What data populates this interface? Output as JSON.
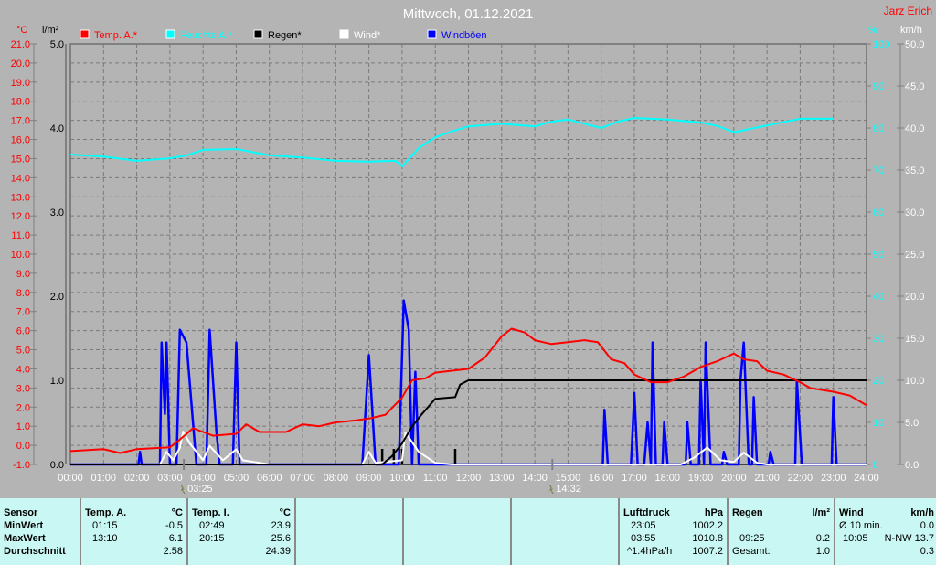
{
  "title": "Mittwoch, 01.12.2021",
  "author": "Jarz Erich",
  "units": {
    "temp": "°C",
    "rain": "l/m²",
    "humidity": "%",
    "wind": "km/h"
  },
  "legend": [
    {
      "label": "Temp. A.*",
      "color": "#ff0000"
    },
    {
      "label": "Feuchte A.*",
      "color": "#00ffff"
    },
    {
      "label": "Regen*",
      "color": "#000000"
    },
    {
      "label": "Wind*",
      "color": "#ffffff"
    },
    {
      "label": "Windböen",
      "color": "#0000ff"
    }
  ],
  "markers": [
    {
      "time": "03:25",
      "hour": 3.42,
      "icon": "sunrise-icon"
    },
    {
      "time": "14:32",
      "hour": 14.53,
      "icon": "sunset-icon"
    }
  ],
  "chart_data": {
    "type": "line",
    "title": "Mittwoch, 01.12.2021",
    "x_ticks": [
      "00:00",
      "01:00",
      "02:00",
      "03:00",
      "04:00",
      "05:00",
      "06:00",
      "07:00",
      "08:00",
      "09:00",
      "10:00",
      "11:00",
      "12:00",
      "13:00",
      "14:00",
      "15:00",
      "16:00",
      "17:00",
      "18:00",
      "19:00",
      "20:00",
      "21:00",
      "22:00",
      "23:00",
      "24:00"
    ],
    "xlim": [
      0,
      24
    ],
    "axes": {
      "temp": {
        "ylim": [
          -1,
          21
        ],
        "ticks": [
          "21.0",
          "20.0",
          "19.0",
          "18.0",
          "17.0",
          "16.0",
          "15.0",
          "14.0",
          "13.0",
          "12.0",
          "11.0",
          "10.0",
          "9.0",
          "8.0",
          "7.0",
          "6.0",
          "5.0",
          "4.0",
          "3.0",
          "2.0",
          "1.0",
          "0.0",
          "-1.0"
        ],
        "color": "#ff0000"
      },
      "rain": {
        "ylim": [
          0,
          5
        ],
        "ticks": [
          "5.0",
          "4.0",
          "3.0",
          "2.0",
          "1.0",
          "0.0"
        ],
        "color": "#000000"
      },
      "humidity": {
        "ylim": [
          0,
          100
        ],
        "ticks": [
          "100",
          "90",
          "80",
          "70",
          "60",
          "50",
          "40",
          "30",
          "20",
          "10",
          "0"
        ],
        "color": "#00ffff"
      },
      "wind": {
        "ylim": [
          0,
          50
        ],
        "ticks": [
          "50.0",
          "45.0",
          "40.0",
          "35.0",
          "30.0",
          "25.0",
          "20.0",
          "15.0",
          "10.0",
          "5.0",
          "0.0"
        ],
        "color": "#ffffff"
      }
    },
    "grid": true,
    "series": [
      {
        "name": "Temp. A.*",
        "axis": "temp",
        "color": "#ff0000",
        "points": [
          [
            0,
            -0.3
          ],
          [
            1,
            -0.2
          ],
          [
            1.5,
            -0.4
          ],
          [
            2,
            -0.2
          ],
          [
            3,
            -0.1
          ],
          [
            3.3,
            0.3
          ],
          [
            3.7,
            0.9
          ],
          [
            4,
            0.7
          ],
          [
            4.3,
            0.5
          ],
          [
            5,
            0.6
          ],
          [
            5.3,
            1.1
          ],
          [
            5.7,
            0.7
          ],
          [
            6.5,
            0.7
          ],
          [
            7,
            1.1
          ],
          [
            7.5,
            1.0
          ],
          [
            8,
            1.2
          ],
          [
            8.6,
            1.3
          ],
          [
            9,
            1.4
          ],
          [
            9.5,
            1.6
          ],
          [
            10,
            2.5
          ],
          [
            10.3,
            3.4
          ],
          [
            10.7,
            3.5
          ],
          [
            11,
            3.8
          ],
          [
            11.5,
            3.9
          ],
          [
            12,
            4.0
          ],
          [
            12.5,
            4.6
          ],
          [
            13,
            5.7
          ],
          [
            13.3,
            6.1
          ],
          [
            13.7,
            5.9
          ],
          [
            14,
            5.5
          ],
          [
            14.5,
            5.3
          ],
          [
            15,
            5.4
          ],
          [
            15.5,
            5.5
          ],
          [
            15.9,
            5.4
          ],
          [
            16.3,
            4.5
          ],
          [
            16.7,
            4.3
          ],
          [
            17,
            3.7
          ],
          [
            17.5,
            3.3
          ],
          [
            18,
            3.3
          ],
          [
            18.5,
            3.6
          ],
          [
            19,
            4.1
          ],
          [
            19.5,
            4.4
          ],
          [
            20,
            4.8
          ],
          [
            20.3,
            4.5
          ],
          [
            20.7,
            4.4
          ],
          [
            21,
            3.9
          ],
          [
            21.5,
            3.7
          ],
          [
            22,
            3.3
          ],
          [
            22.3,
            3.0
          ],
          [
            23,
            2.8
          ],
          [
            23.5,
            2.6
          ],
          [
            24,
            2.1
          ]
        ]
      },
      {
        "name": "Feuchte A.*",
        "axis": "humidity",
        "color": "#00ffff",
        "points": [
          [
            0,
            73.7
          ],
          [
            1,
            73.2
          ],
          [
            2,
            72.2
          ],
          [
            3,
            72.8
          ],
          [
            3.5,
            73.5
          ],
          [
            4,
            74.8
          ],
          [
            5,
            75
          ],
          [
            6,
            73.5
          ],
          [
            7,
            73
          ],
          [
            8,
            72.2
          ],
          [
            9,
            72
          ],
          [
            9.8,
            72.2
          ],
          [
            10,
            70.9
          ],
          [
            10.5,
            75.2
          ],
          [
            11,
            77.8
          ],
          [
            11.5,
            79.2
          ],
          [
            12,
            80.4
          ],
          [
            13,
            81
          ],
          [
            14,
            80.4
          ],
          [
            14.5,
            81.5
          ],
          [
            15,
            82
          ],
          [
            16,
            80
          ],
          [
            16.5,
            81.5
          ],
          [
            17,
            82.4
          ],
          [
            18,
            82
          ],
          [
            19,
            81.3
          ],
          [
            19.5,
            80.5
          ],
          [
            20,
            79
          ],
          [
            21,
            80.6
          ],
          [
            22,
            82.2
          ],
          [
            23,
            82.2
          ]
        ]
      },
      {
        "name": "Regen*",
        "axis": "rain",
        "color": "#000000",
        "points": [
          [
            0,
            0
          ],
          [
            9.4,
            0
          ],
          [
            9.7,
            0.1
          ],
          [
            10,
            0.25
          ],
          [
            10.3,
            0.45
          ],
          [
            10.6,
            0.6
          ],
          [
            11,
            0.78
          ],
          [
            11.6,
            0.8
          ],
          [
            11.75,
            0.95
          ],
          [
            12,
            1.0
          ],
          [
            24,
            1.0
          ]
        ]
      },
      {
        "name": "Wind*",
        "axis": "wind",
        "color": "#ffffff",
        "points": [
          [
            0,
            0
          ],
          [
            2.7,
            0
          ],
          [
            2.9,
            1.5
          ],
          [
            3.1,
            0.5
          ],
          [
            3.3,
            2
          ],
          [
            3.4,
            3.9
          ],
          [
            3.6,
            2.5
          ],
          [
            4,
            0.5
          ],
          [
            4.2,
            2.2
          ],
          [
            4.6,
            0.5
          ],
          [
            5,
            1.8
          ],
          [
            5.2,
            0.5
          ],
          [
            6,
            0
          ],
          [
            8.8,
            0
          ],
          [
            9,
            1.5
          ],
          [
            9.2,
            0.2
          ],
          [
            10,
            0.5
          ],
          [
            10.1,
            3.8
          ],
          [
            10.5,
            1.5
          ],
          [
            11,
            0.2
          ],
          [
            11.5,
            0
          ],
          [
            18.4,
            0
          ],
          [
            18.8,
            0.8
          ],
          [
            19.2,
            2
          ],
          [
            19.6,
            0.5
          ],
          [
            20,
            0.3
          ],
          [
            20.3,
            1.4
          ],
          [
            20.7,
            0.2
          ],
          [
            21,
            0
          ],
          [
            24,
            0
          ]
        ]
      },
      {
        "name": "Windböen",
        "axis": "wind",
        "color": "#0000ff",
        "points": [
          [
            0,
            0
          ],
          [
            2.05,
            0
          ],
          [
            2.1,
            1.5
          ],
          [
            2.15,
            0
          ],
          [
            2.7,
            0
          ],
          [
            2.75,
            14.5
          ],
          [
            2.85,
            6
          ],
          [
            2.9,
            14.5
          ],
          [
            3.0,
            0
          ],
          [
            3.2,
            0
          ],
          [
            3.3,
            16
          ],
          [
            3.5,
            14.5
          ],
          [
            3.8,
            0
          ],
          [
            4.1,
            0
          ],
          [
            4.2,
            16
          ],
          [
            4.4,
            4
          ],
          [
            4.5,
            0
          ],
          [
            4.9,
            0
          ],
          [
            5.0,
            14.5
          ],
          [
            5.1,
            0
          ],
          [
            8.8,
            0
          ],
          [
            9.0,
            13
          ],
          [
            9.2,
            0
          ],
          [
            9.9,
            0
          ],
          [
            10.05,
            19.5
          ],
          [
            10.2,
            16
          ],
          [
            10.3,
            0
          ],
          [
            10.4,
            11
          ],
          [
            10.5,
            0
          ],
          [
            16.05,
            0
          ],
          [
            16.1,
            6.5
          ],
          [
            16.2,
            0
          ],
          [
            16.9,
            0
          ],
          [
            17.0,
            8.5
          ],
          [
            17.1,
            0
          ],
          [
            17.3,
            0
          ],
          [
            17.4,
            5
          ],
          [
            17.5,
            0
          ],
          [
            17.55,
            14.5
          ],
          [
            17.65,
            0
          ],
          [
            17.85,
            0
          ],
          [
            17.9,
            5
          ],
          [
            18.0,
            0
          ],
          [
            18.55,
            0
          ],
          [
            18.6,
            5
          ],
          [
            18.7,
            0
          ],
          [
            18.95,
            0
          ],
          [
            19.0,
            10
          ],
          [
            19.1,
            0
          ],
          [
            19.15,
            14.5
          ],
          [
            19.3,
            0
          ],
          [
            19.65,
            0
          ],
          [
            19.7,
            1.5
          ],
          [
            19.8,
            0
          ],
          [
            20.15,
            0
          ],
          [
            20.2,
            10
          ],
          [
            20.3,
            14.5
          ],
          [
            20.45,
            0
          ],
          [
            20.55,
            0
          ],
          [
            20.6,
            8
          ],
          [
            20.7,
            0
          ],
          [
            21.05,
            0
          ],
          [
            21.1,
            1.5
          ],
          [
            21.2,
            0
          ],
          [
            21.85,
            0
          ],
          [
            21.9,
            10
          ],
          [
            22.05,
            0
          ],
          [
            22.95,
            0
          ],
          [
            23.0,
            8
          ],
          [
            23.1,
            0
          ],
          [
            24,
            0
          ]
        ]
      }
    ],
    "rain_bars": [
      [
        9.4,
        0.2
      ],
      [
        9.75,
        0.2
      ],
      [
        10.0,
        0.2
      ],
      [
        10.3,
        0.2
      ],
      [
        11.6,
        0.2
      ]
    ]
  },
  "table": {
    "temp_a": {
      "sensor": "Sensor",
      "header": "Temp. A.",
      "unit": "°C",
      "min_label": "MinWert",
      "max_label": "MaxWert",
      "avg_label": "Durchschnitt",
      "min_time": "01:15",
      "min": "-0.5",
      "max_time": "13:10",
      "max": "6.1",
      "avg": "2.58"
    },
    "temp_i": {
      "header": "Temp. I.",
      "unit": "°C",
      "min_time": "02:49",
      "min": "23.9",
      "max_time": "20:15",
      "max": "25.6",
      "avg": "24.39"
    },
    "pressure": {
      "header": "Luftdruck",
      "unit": "hPa",
      "min_time": "23:05",
      "min": "1002.2",
      "max_time": "03:55",
      "max": "1010.8",
      "trend": "^1.4hPa/h",
      "avg": "1007.2"
    },
    "rain": {
      "header": "Regen",
      "unit": "l/m²",
      "max_time": "09:25",
      "max": "0.2",
      "total_label": "Gesamt:",
      "total": "1.0"
    },
    "wind": {
      "header": "Wind",
      "unit": "km/h",
      "avg_label": "Ø 10 min.",
      "avg": "0.0",
      "max_time": "10:05",
      "max": "N-NW 13.7",
      "mean": "0.3"
    }
  }
}
